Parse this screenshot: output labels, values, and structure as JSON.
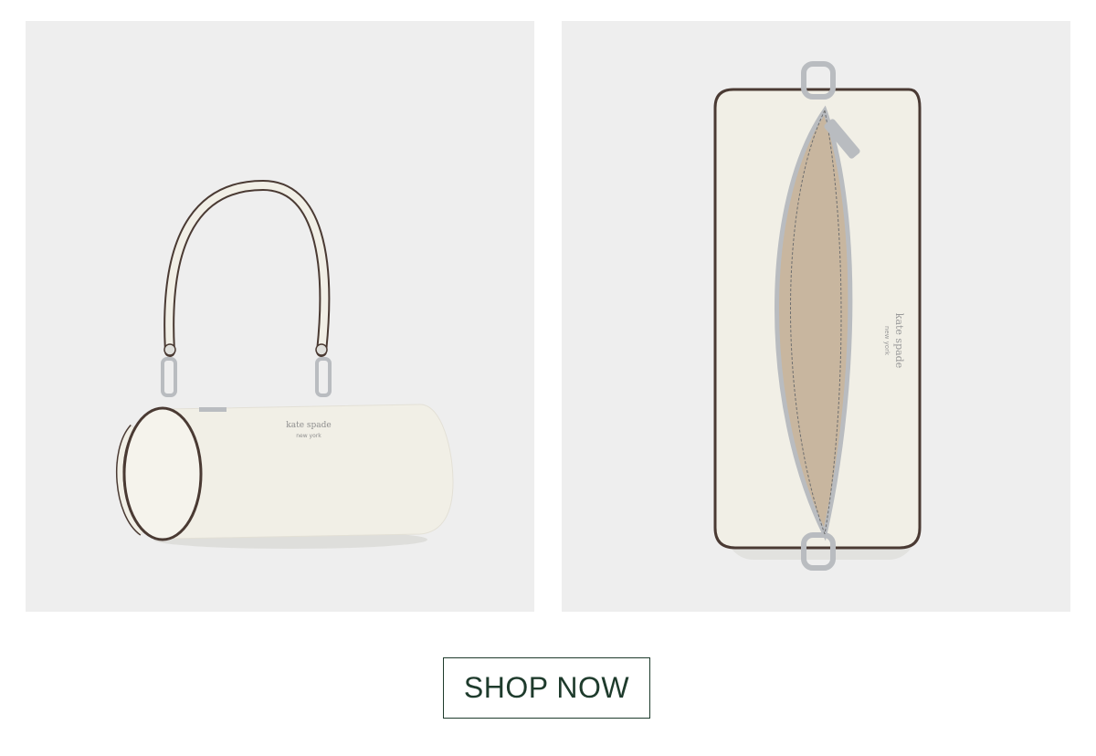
{
  "products": [
    {
      "view": "side view, shoulder strap",
      "logo_line1": "kate spade",
      "logo_line2": "new york"
    },
    {
      "view": "top view, open zipper",
      "logo_line1": "kate spade",
      "logo_line2": "new york"
    }
  ],
  "cta": {
    "label": "SHOP NOW",
    "color": "#1e3b2c"
  },
  "colors": {
    "panel_bg": "#eeeeee",
    "bag": "#f1efe6",
    "lining": "#c8b69f",
    "trim": "#4a3a33",
    "hardware": "#b9bcc0"
  }
}
